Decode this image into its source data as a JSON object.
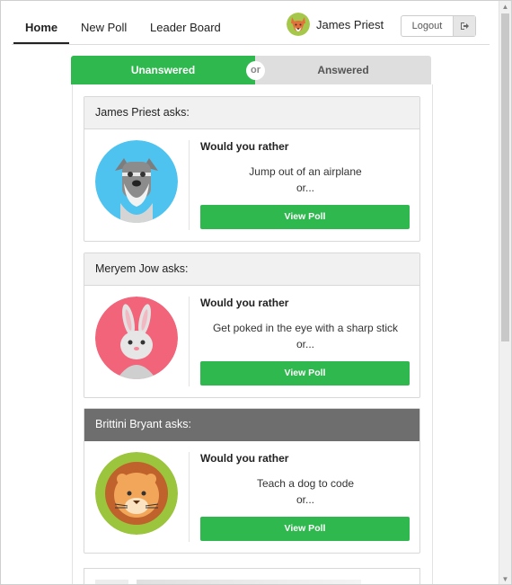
{
  "nav": {
    "tabs": [
      {
        "label": "Home",
        "active": true
      },
      {
        "label": "New Poll",
        "active": false
      },
      {
        "label": "Leader Board",
        "active": false
      }
    ],
    "user_name": "James Priest",
    "user_avatar_icon": "fox-icon",
    "logout_label": "Logout",
    "logout_icon": "sign-out-icon"
  },
  "toggle": {
    "left_label": "Unanswered",
    "or_label": "or",
    "right_label": "Answered",
    "active": "Unanswered"
  },
  "questions": [
    {
      "author_line": "James Priest asks:",
      "avatar_icon": "schnauzer-dog-icon",
      "would_you_rather": "Would you rather",
      "option_text": "Jump out of an airplane",
      "or_text": "or...",
      "button_label": "View Poll"
    },
    {
      "author_line": "Meryem Jow asks:",
      "avatar_icon": "rabbit-icon",
      "would_you_rather": "Would you rather",
      "option_text": "Get poked in the eye with a sharp stick",
      "or_text": "or...",
      "button_label": "View Poll"
    },
    {
      "author_line": "Brittini Bryant asks:",
      "avatar_icon": "lion-icon",
      "would_you_rather": "Would you rather",
      "option_text": "Teach a dog to code",
      "or_text": "or...",
      "button_label": "View Poll"
    }
  ],
  "colors": {
    "accent_green": "#2eb84e",
    "header_dark": "#6e6e6e",
    "header_light": "#f1f1f1",
    "toggle_inactive": "#dedede"
  }
}
